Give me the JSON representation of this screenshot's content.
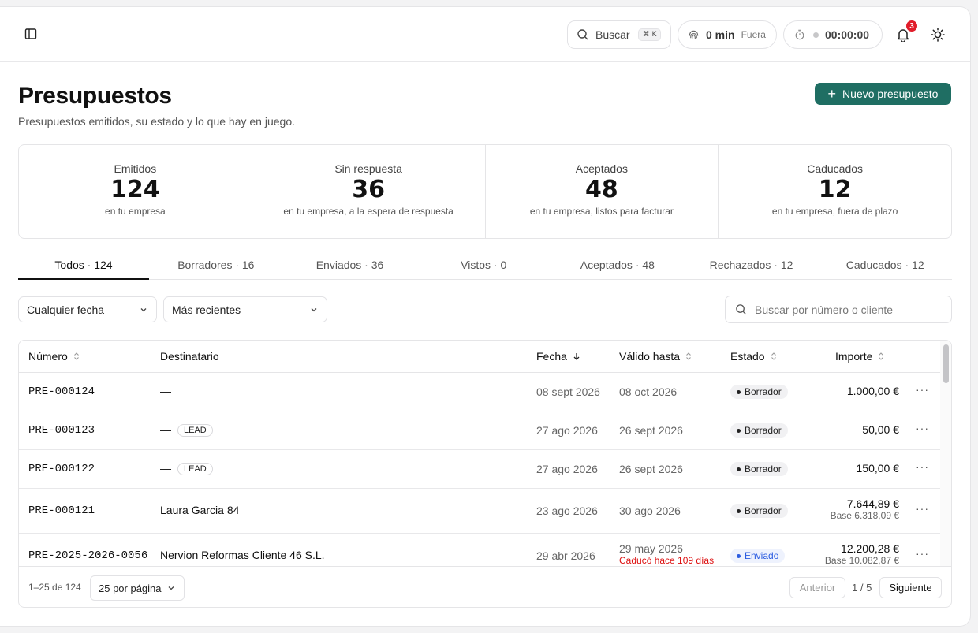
{
  "header": {
    "search_label": "Buscar",
    "search_kbd": "⌘ K",
    "away_minutes": "0 min",
    "away_label": "Fuera",
    "timer": "00:00:00",
    "notifications_count": "3"
  },
  "page": {
    "title": "Presupuestos",
    "subtitle": "Presupuestos emitidos, su estado y lo que hay en juego.",
    "new_button": "Nuevo presupuesto"
  },
  "stats": [
    {
      "label": "Emitidos",
      "value": "124",
      "desc": "en tu empresa"
    },
    {
      "label": "Sin respuesta",
      "value": "36",
      "desc": "en tu empresa, a la espera de respuesta"
    },
    {
      "label": "Aceptados",
      "value": "48",
      "desc": "en tu empresa, listos para facturar"
    },
    {
      "label": "Caducados",
      "value": "12",
      "desc": "en tu empresa, fuera de plazo"
    }
  ],
  "tabs": [
    {
      "label": "Todos · 124"
    },
    {
      "label": "Borradores · 16"
    },
    {
      "label": "Enviados · 36"
    },
    {
      "label": "Vistos · 0"
    },
    {
      "label": "Aceptados · 48"
    },
    {
      "label": "Rechazados · 12"
    },
    {
      "label": "Caducados · 12"
    }
  ],
  "filters": {
    "date_filter": "Cualquier fecha",
    "sort": "Más recientes",
    "search_placeholder": "Buscar por número o cliente"
  },
  "table": {
    "columns": {
      "number": "Número",
      "recipient": "Destinatario",
      "date": "Fecha",
      "valid_until": "Válido hasta",
      "status": "Estado",
      "amount": "Importe"
    },
    "rows": [
      {
        "number": "PRE-000124",
        "recipient": "—",
        "lead": "",
        "date": "08 sept 2026",
        "valid": "08 oct 2026",
        "expired": "",
        "status": "Borrador",
        "amount": "1.000,00 €",
        "base": ""
      },
      {
        "number": "PRE-000123",
        "recipient": "—",
        "lead": "LEAD",
        "date": "27 ago 2026",
        "valid": "26 sept 2026",
        "expired": "",
        "status": "Borrador",
        "amount": "50,00 €",
        "base": ""
      },
      {
        "number": "PRE-000122",
        "recipient": "—",
        "lead": "LEAD",
        "date": "27 ago 2026",
        "valid": "26 sept 2026",
        "expired": "",
        "status": "Borrador",
        "amount": "150,00 €",
        "base": ""
      },
      {
        "number": "PRE-000121",
        "recipient": "Laura Garcia 84",
        "lead": "",
        "date": "23 ago 2026",
        "valid": "30 ago 2026",
        "expired": "",
        "status": "Borrador",
        "amount": "7.644,89 €",
        "base": "Base 6.318,09 €"
      },
      {
        "number": "PRE-2025-2026-0056",
        "recipient": "Nervion Reformas Cliente 46 S.L.",
        "lead": "",
        "date": "29 abr 2026",
        "valid": "29 may 2026",
        "expired": "Caducó hace 109 días",
        "status": "Enviado",
        "amount": "12.200,28 €",
        "base": "Base 10.082,87 €"
      }
    ]
  },
  "footer": {
    "range": "1–25 de 124",
    "per_page": "25 por página",
    "prev": "Anterior",
    "page": "1 / 5",
    "next": "Siguiente"
  },
  "colors": {
    "primary": "#1f6e63",
    "notification": "#e11d2a",
    "sent_status": "#2b5ce0",
    "expired_text": "#dd1111"
  }
}
